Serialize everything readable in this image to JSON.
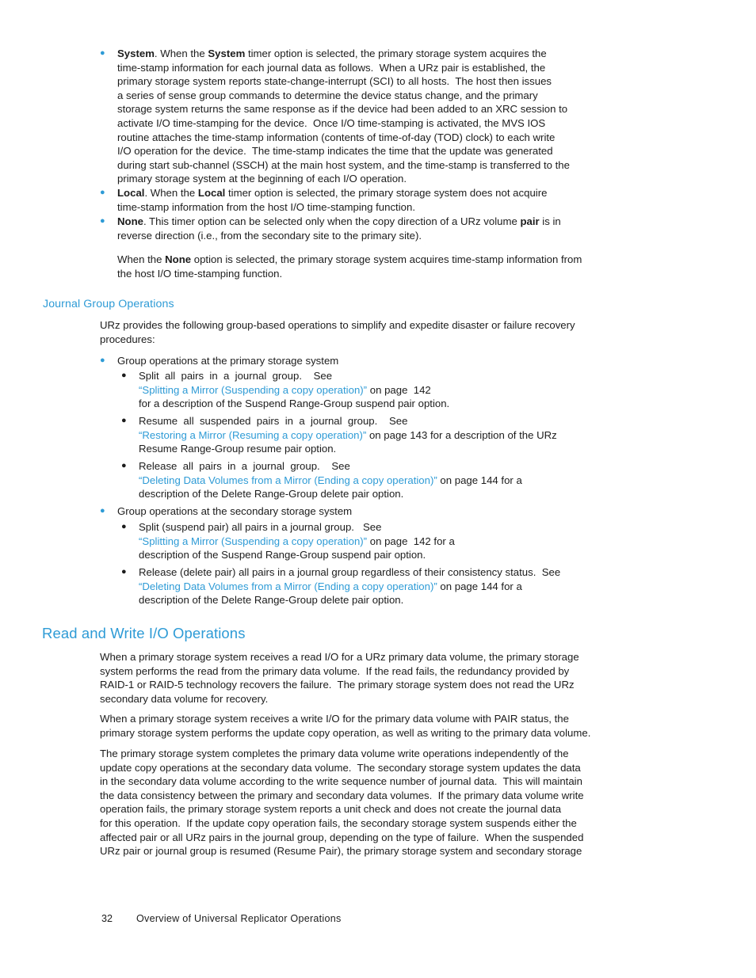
{
  "page": {
    "number": "32",
    "footer_title": "Overview of Universal Replicator Operations",
    "heading_color": "#2e9bd6",
    "body_color": "#1c1c1c"
  },
  "timer_options": {
    "system": {
      "term": "System",
      "lines": [
        ". When the ",
        " timer option is selected, the primary storage system acquires the",
        "time-stamp information for each journal data as follows.  When a URz pair is established, the",
        "primary storage system reports state-change-interrupt (SCI) to all hosts.  The host then issues",
        "a series of sense group commands to determine the device status change, and the primary",
        "storage system returns the same response as if the device had been added to an XRC session to",
        "activate I/O time-stamping for the device.  Once I/O time-stamping is activated, the MVS IOS",
        "routine attaches the time-stamp information (contents of time-of-day (TOD) clock) to each write",
        "I/O operation for the device.  The time-stamp indicates the time that the update was generated",
        "during start sub-channel (SSCH) at the main host system, and the time-stamp is transferred to the",
        "primary storage system at the beginning of each I/O operation."
      ]
    },
    "local": {
      "term": "Local",
      "line1_a": ". When the ",
      "line1_b": " timer option is selected, the primary storage system does not acquire",
      "line2": "time-stamp information from the host I/O time-stamping function."
    },
    "none": {
      "term": "None",
      "line1_a": ". This timer option can be selected only when the copy direction of a URz volume ",
      "bold_pair": "pair",
      "line1_b": " is in",
      "line2": "reverse direction (i.e., from the secondary site to the primary site).",
      "para_a": "When the ",
      "para_bold": "None",
      "para_b": " option is selected, the primary storage system acquires time-stamp information from",
      "para_line2": "the host I/O time-stamping function."
    }
  },
  "journal_group": {
    "heading": "Journal Group Operations",
    "intro_line1": "URz provides the following group-based operations to simplify and expedite disaster or failure recovery",
    "intro_line2": "procedures:",
    "primary_group_label": "Group operations at the primary storage system",
    "secondary_group_label": "Group operations at the secondary storage system",
    "primary_items": [
      {
        "line1": "Split  all  pairs  in  a  journal  group.    See",
        "link": "“Splitting a Mirror (Suspending a copy operation)”",
        "after_link": " on page  142",
        "line3": "for a description of the Suspend Range-Group suspend pair option."
      },
      {
        "line1": "Resume  all  suspended  pairs  in  a  journal  group.    See",
        "link": "“Restoring a Mirror (Resuming a copy operation)”",
        "after_link": " on page 143 for a description of the URz",
        "line3": "Resume Range-Group resume pair option."
      },
      {
        "line1": "Release  all  pairs  in  a  journal  group.    See",
        "link": "“Deleting Data Volumes from a Mirror (Ending a copy operation)”",
        "after_link": " on page 144 for a",
        "line3": "description of the Delete Range-Group delete pair option."
      }
    ],
    "secondary_items": [
      {
        "line1": "Split (suspend pair) all pairs in a journal group.   See",
        "link": "“Splitting a Mirror (Suspending a copy operation)”",
        "after_link": " on page  142 for a",
        "line3": "description of the Suspend Range-Group suspend pair option."
      },
      {
        "line1": "Release (delete pair) all pairs in a journal group regardless of their consistency status.  See",
        "link": "“Deleting Data Volumes from a Mirror (Ending a copy operation)”",
        "after_link": " on page 144 for a",
        "line3": "description of the Delete Range-Group delete pair option."
      }
    ]
  },
  "read_write": {
    "heading": "Read and Write I/O Operations",
    "para1": [
      "When a primary storage system receives a read I/O for a URz primary data volume, the primary storage",
      "system performs the read from the primary data volume.  If the read fails, the redundancy provided by",
      "RAID-1 or RAID-5 technology recovers the failure.  The primary storage system does not read the URz",
      "secondary data volume for recovery."
    ],
    "para2": [
      "When a primary storage system receives a write I/O for the primary data volume with PAIR status, the",
      "primary storage system performs the update copy operation, as well as writing to the primary data volume."
    ],
    "para3": [
      "The primary storage system completes the primary data volume write operations independently of the",
      "update copy operations at the secondary data volume.  The secondary storage system updates the data",
      "in the secondary data volume according to the write sequence number of journal data.  This will maintain",
      "the data consistency between the primary and secondary data volumes.  If the primary data volume write",
      "operation fails, the primary storage system reports a unit check and does not create the journal data",
      "for this operation.  If the update copy operation fails, the secondary storage system suspends either the",
      "affected pair or all URz pairs in the journal group, depending on the type of failure.  When the suspended",
      "URz pair or journal group is resumed (Resume Pair), the primary storage system and secondary storage"
    ]
  }
}
